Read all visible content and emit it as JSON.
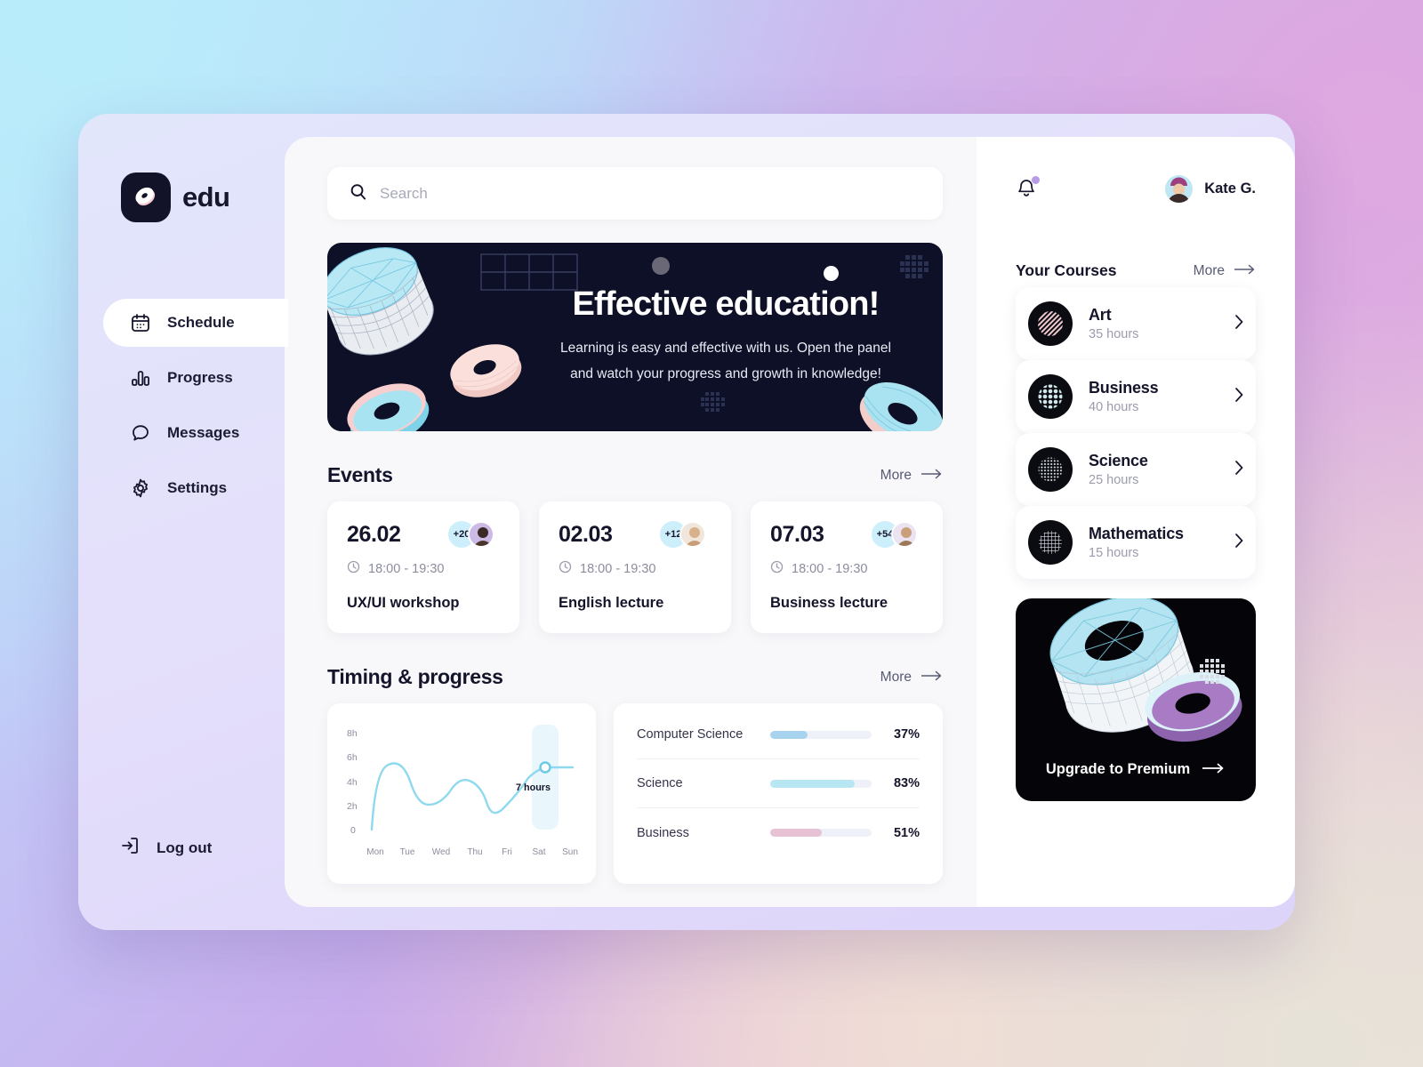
{
  "brand": {
    "name": "edu",
    "logo_icon": "torus-logo-icon"
  },
  "sidebar": {
    "items": [
      {
        "label": "Schedule",
        "icon": "calendar-icon",
        "active": true
      },
      {
        "label": "Progress",
        "icon": "bar-chart-icon",
        "active": false
      },
      {
        "label": "Messages",
        "icon": "chat-bubble-icon",
        "active": false
      },
      {
        "label": "Settings",
        "icon": "gear-icon",
        "active": false
      }
    ],
    "logout": {
      "label": "Log out",
      "icon": "logout-icon"
    }
  },
  "search": {
    "placeholder": "Search",
    "value": "",
    "icon": "search-icon"
  },
  "banner": {
    "title": "Effective education!",
    "subtitle_line1": "Learning is easy and effective with us. Open the panel",
    "subtitle_line2": "and watch your progress and growth in knowledge!"
  },
  "events": {
    "section_title": "Events",
    "more_label": "More",
    "cards": [
      {
        "date": "26.02",
        "badge": "+20",
        "time": "18:00 - 19:30",
        "name": "UX/UI workshop",
        "clock_icon": "clock-icon"
      },
      {
        "date": "02.03",
        "badge": "+12",
        "time": "18:00 - 19:30",
        "name": "English lecture",
        "clock_icon": "clock-icon"
      },
      {
        "date": "07.03",
        "badge": "+54",
        "time": "18:00 - 19:30",
        "name": "Business lecture",
        "clock_icon": "clock-icon"
      }
    ]
  },
  "timing": {
    "section_title": "Timing & progress",
    "more_label": "More"
  },
  "chart_data": [
    {
      "type": "line",
      "title": "Timing & progress",
      "x": [
        "Mon",
        "Tue",
        "Wed",
        "Thu",
        "Fri",
        "Sat",
        "Sun"
      ],
      "values": [
        0,
        6,
        3,
        5,
        3,
        7,
        7
      ],
      "ylabel": "",
      "xlabel": "",
      "ytick_labels": [
        "0",
        "2h",
        "4h",
        "6h",
        "8h"
      ],
      "ytick_values": [
        0,
        2,
        4,
        6,
        8
      ],
      "ylim": [
        0,
        8
      ],
      "grid": false,
      "legend": "none",
      "annotation": {
        "label": "7 hours",
        "x": "Sat",
        "y": 7
      },
      "line_color": "#8fd9ef",
      "highlight_band": "Sat"
    },
    {
      "type": "bar",
      "orientation": "horizontal",
      "title": "",
      "categories": [
        "Computer Science",
        "Science",
        "Business"
      ],
      "values": [
        37,
        83,
        51
      ],
      "value_labels": [
        "37%",
        "83%",
        "51%"
      ],
      "ylim": [
        0,
        100
      ],
      "colors": [
        "#a8d3ef",
        "#b6e7f3",
        "#e6c2d4"
      ],
      "grid": false,
      "legend": "none"
    }
  ],
  "topbar": {
    "bell_icon": "bell-icon",
    "has_notification": true,
    "user_name": "Kate G.",
    "avatar_icon": "avatar"
  },
  "courses": {
    "section_title": "Your Courses",
    "more_label": "More",
    "items": [
      {
        "name": "Art",
        "hours": "35 hours",
        "icon": "striped-circle-icon",
        "chevron": "chevron-right-icon"
      },
      {
        "name": "Business",
        "hours": "40 hours",
        "icon": "dotted-circle-icon",
        "chevron": "chevron-right-icon"
      },
      {
        "name": "Science",
        "hours": "25 hours",
        "icon": "dot-grid-circle-icon",
        "chevron": "chevron-right-icon"
      },
      {
        "name": "Mathematics",
        "hours": "15 hours",
        "icon": "grid-circle-icon",
        "chevron": "chevron-right-icon"
      }
    ]
  },
  "promo": {
    "label": "Upgrade to Premium",
    "arrow_icon": "arrow-right-icon"
  },
  "colors": {
    "accent_cyan": "#8fd9ef",
    "accent_pink": "#e6c2d4",
    "accent_blue": "#a8d3ef",
    "dark": "#14142b",
    "banner_bg": "#0d1026",
    "notification": "#b79ae8"
  }
}
